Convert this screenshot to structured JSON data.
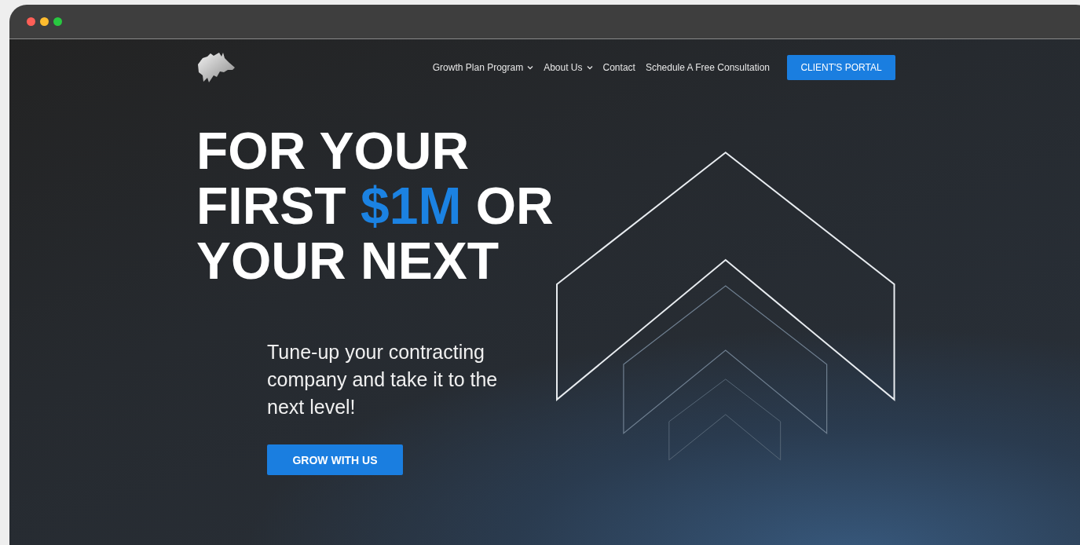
{
  "nav": {
    "links": [
      {
        "label": "Growth Plan Program",
        "has_dropdown": true
      },
      {
        "label": "About Us",
        "has_dropdown": true
      },
      {
        "label": "Contact",
        "has_dropdown": false
      },
      {
        "label": "Schedule A Free Consultation",
        "has_dropdown": false
      }
    ],
    "portal_button": "CLIENT'S PORTAL"
  },
  "hero": {
    "headline_lines": [
      [
        {
          "text": "FOR YOUR",
          "highlight": false
        }
      ],
      [
        {
          "text": "FIRST ",
          "highlight": false
        },
        {
          "text": "$1M",
          "highlight": true
        },
        {
          "text": " OR",
          "highlight": false
        }
      ],
      [
        {
          "text": "YOUR NEXT",
          "highlight": false
        }
      ]
    ],
    "subtitle": "Tune-up your contracting company and take it to the next level!",
    "cta_button": "GROW WITH US"
  }
}
